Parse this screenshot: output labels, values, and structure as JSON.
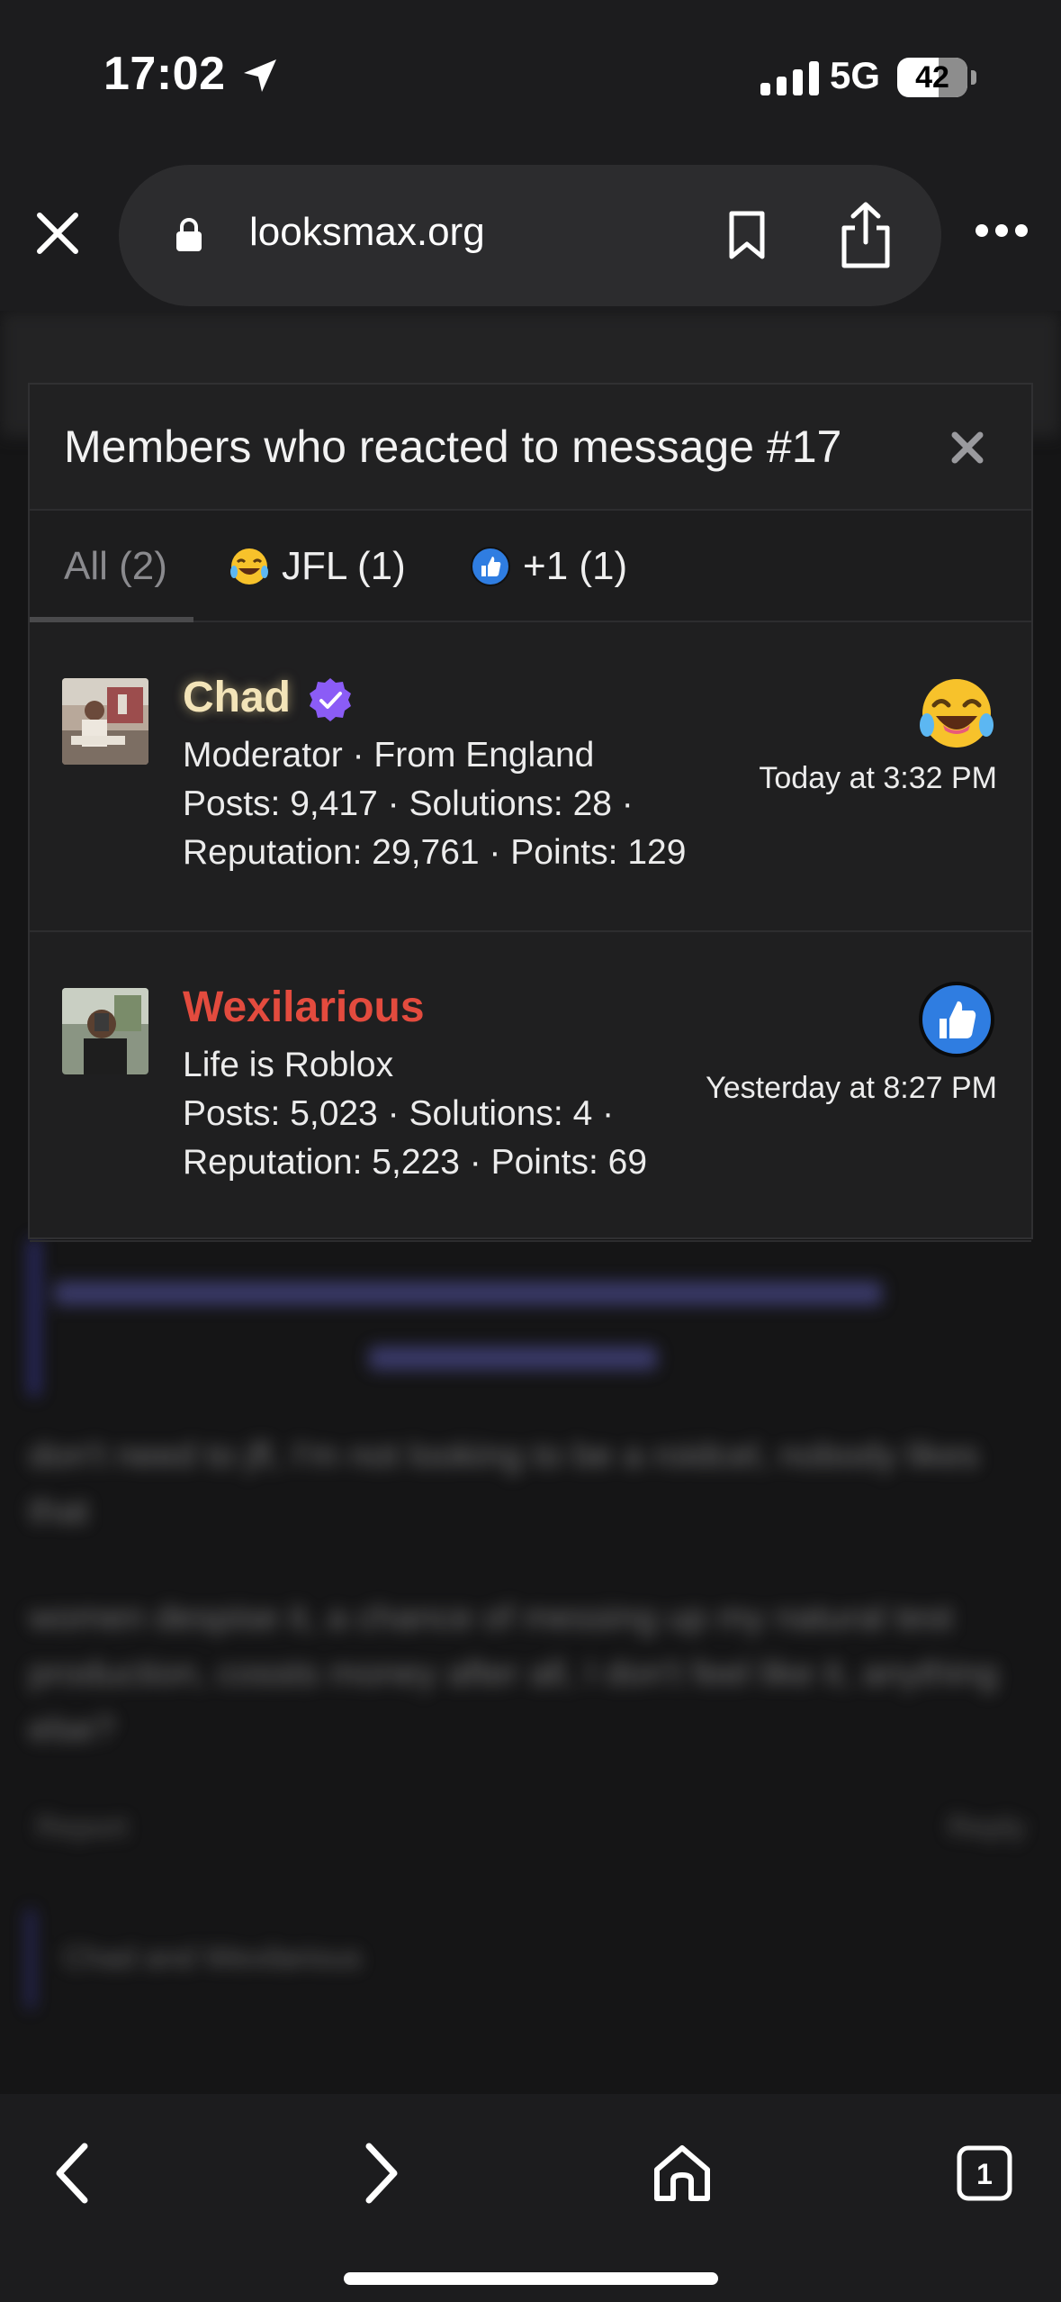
{
  "status": {
    "time": "17:02",
    "network": "5G",
    "battery": "42"
  },
  "browser": {
    "url": "looksmax.org"
  },
  "background": {
    "quote_lines": [
      "was planning to take fatburners and maybe dutasteride",
      "Click to expand..."
    ],
    "paragraph1": "don't need to jfl, I'm not looking to be a roidcel, nobody likes that",
    "paragraph2": "women despise it, a chance of messing up my natural test production, cossts money after all, I don't feel like it, anything else?",
    "report": "Report",
    "reply": "Reply",
    "reactions_summary": "Chad and Wexilarious"
  },
  "modal": {
    "title": "Members who reacted to message #17",
    "tabs": [
      {
        "label": "All (2)"
      },
      {
        "label": "JFL (1)",
        "icon": "laughing-crying-emoji-icon"
      },
      {
        "label": "+1 (1)",
        "icon": "thumbs-up-icon"
      }
    ],
    "members": [
      {
        "name": "Chad",
        "role_line": "Moderator · From England",
        "stats_line1": "Posts: 9,417 · Solutions: 28 ·",
        "stats_line2": "Reputation: 29,761 · Points: 129",
        "time": "Today at 3:32 PM",
        "reaction": "laughing-crying-emoji-icon",
        "verified": true
      },
      {
        "name": "Wexilarious",
        "role_line": "Life is Roblox",
        "stats_line1": "Posts: 5,023 · Solutions: 4 ·",
        "stats_line2": "Reputation: 5,223 · Points: 69",
        "time": "Yesterday at 8:27 PM",
        "reaction": "thumbs-up-icon",
        "verified": false
      }
    ]
  },
  "colors": {
    "chad_name": "#f3e4b8",
    "wex_name": "#e34b3e",
    "verified_badge": "#8b5cf6",
    "thumbs_blue": "#2f7de1"
  }
}
